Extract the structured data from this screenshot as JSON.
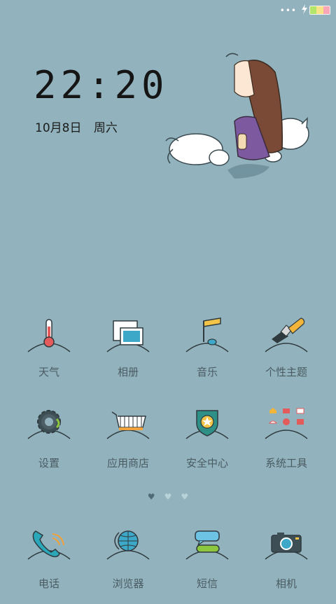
{
  "status_bar": {
    "dots": "•••",
    "icons": [
      "more-dots-icon",
      "charging-bolt-icon",
      "battery-icon"
    ],
    "battery_colors": [
      "#b4e56b",
      "#f7e38a",
      "#f9a7b6"
    ]
  },
  "clock": {
    "time": "22:20",
    "date": "10月8日",
    "weekday": "周六"
  },
  "apps": [
    {
      "label": "天气",
      "icon": "thermometer-icon"
    },
    {
      "label": "相册",
      "icon": "photo-frames-icon"
    },
    {
      "label": "音乐",
      "icon": "music-note-icon"
    },
    {
      "label": "个性主题",
      "icon": "paint-brush-icon"
    },
    {
      "label": "设置",
      "icon": "gear-icon"
    },
    {
      "label": "应用商店",
      "icon": "shopping-cart-icon"
    },
    {
      "label": "安全中心",
      "icon": "shield-star-icon"
    },
    {
      "label": "系统工具",
      "icon": "tools-grid-icon"
    }
  ],
  "pager": {
    "total": 3,
    "active": 0
  },
  "dock": [
    {
      "label": "电话",
      "icon": "phone-icon"
    },
    {
      "label": "浏览器",
      "icon": "globe-icon"
    },
    {
      "label": "短信",
      "icon": "message-bubbles-icon"
    },
    {
      "label": "相机",
      "icon": "camera-icon"
    }
  ],
  "colors": {
    "background": "#92b3bd",
    "label": "#4a5b62",
    "icon_outline": "#2f3a3e"
  }
}
